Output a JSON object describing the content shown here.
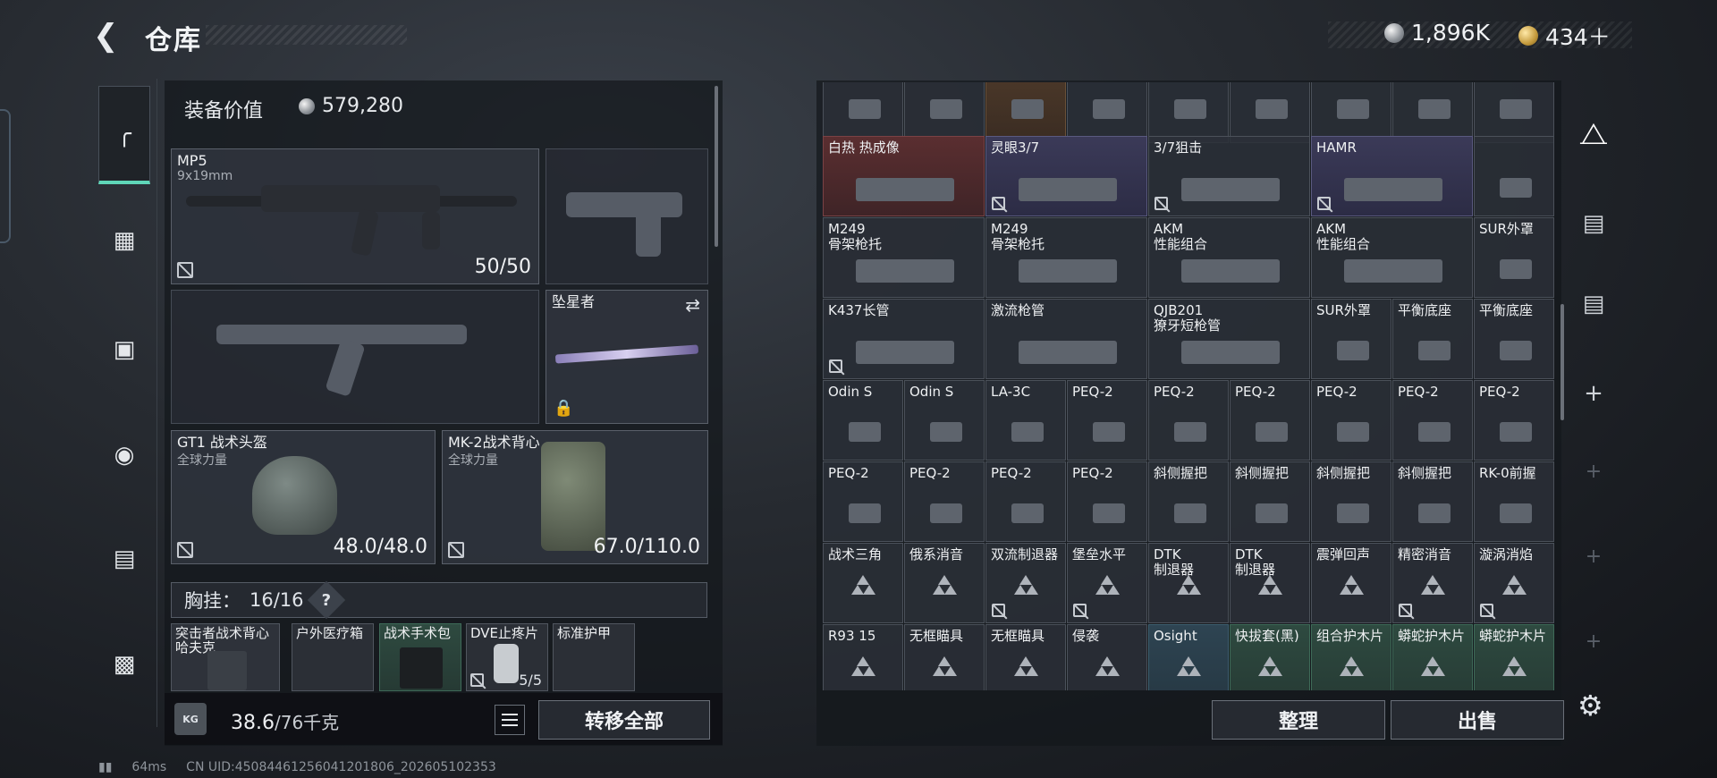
{
  "header": {
    "title": "仓库"
  },
  "currency": {
    "silver": "1,896K",
    "gold": "434＋"
  },
  "equip": {
    "label": "装备价值",
    "value": "579,280"
  },
  "slots": {
    "primary": {
      "name": "MP5",
      "sub": "9x19mm",
      "qty": "50/50"
    },
    "melee": {
      "name": "坠星者"
    },
    "helmet": {
      "name": "GT1 战术头盔",
      "sub": "全球力量",
      "qty": "48.0/48.0"
    },
    "vest": {
      "name": "MK-2战术背心",
      "sub": "全球力量",
      "qty": "67.0/110.0"
    }
  },
  "chest": {
    "label": "胸挂：",
    "count": "16/16",
    "help": "?"
  },
  "chest_items": [
    "突击者战术背心 哈夫克",
    "户外医疗箱",
    "战术手术包",
    "DVE止疼片",
    "标准护甲"
  ],
  "chest_qty": "5/5",
  "weight": {
    "current": "38.6",
    "max": "/76千克"
  },
  "buttons": {
    "transfer_all": "转移全部",
    "sort": "整理",
    "sell": "出售"
  },
  "grid": [
    [
      "",
      "",
      "",
      "",
      "",
      "",
      "",
      "",
      ""
    ],
    [
      "白热 热成像",
      "",
      "灵眼3/7",
      "",
      "3/7狙击",
      "",
      "HAMR",
      "",
      ""
    ],
    [
      "M249\n骨架枪托",
      "",
      "M249\n骨架枪托",
      "",
      "AKM\n性能组合",
      "",
      "AKM\n性能组合",
      "",
      "SUR外罩"
    ],
    [
      "K437长管",
      "",
      "激流枪管",
      "",
      "QJB201\n獠牙短枪管",
      "",
      "SUR外罩",
      "平衡底座",
      "平衡底座"
    ],
    [
      "Odin S",
      "Odin S",
      "LA-3C",
      "PEQ-2",
      "PEQ-2",
      "PEQ-2",
      "PEQ-2",
      "PEQ-2",
      "PEQ-2"
    ],
    [
      "PEQ-2",
      "PEQ-2",
      "PEQ-2",
      "PEQ-2",
      "斜侧握把",
      "斜侧握把",
      "斜侧握把",
      "斜侧握把",
      "RK-0前握"
    ],
    [
      "战术三角",
      "俄系消音",
      "双流制退器",
      "堡垒水平",
      "DTK\n制退器",
      "DTK\n制退器",
      "震弹回声",
      "精密消音",
      "漩涡消焰"
    ],
    [
      "R93 15",
      "无框瞄具",
      "无框瞄具",
      "侵袭",
      "Osight",
      "快拔套(黑)",
      "组合护木片",
      "蟒蛇护木片",
      "蟒蛇护木片"
    ]
  ],
  "status": {
    "ping": "64ms",
    "uid": "CN UID:45084461256041201806_202605102353"
  },
  "colors": {
    "accent": "#5fd6b8"
  }
}
